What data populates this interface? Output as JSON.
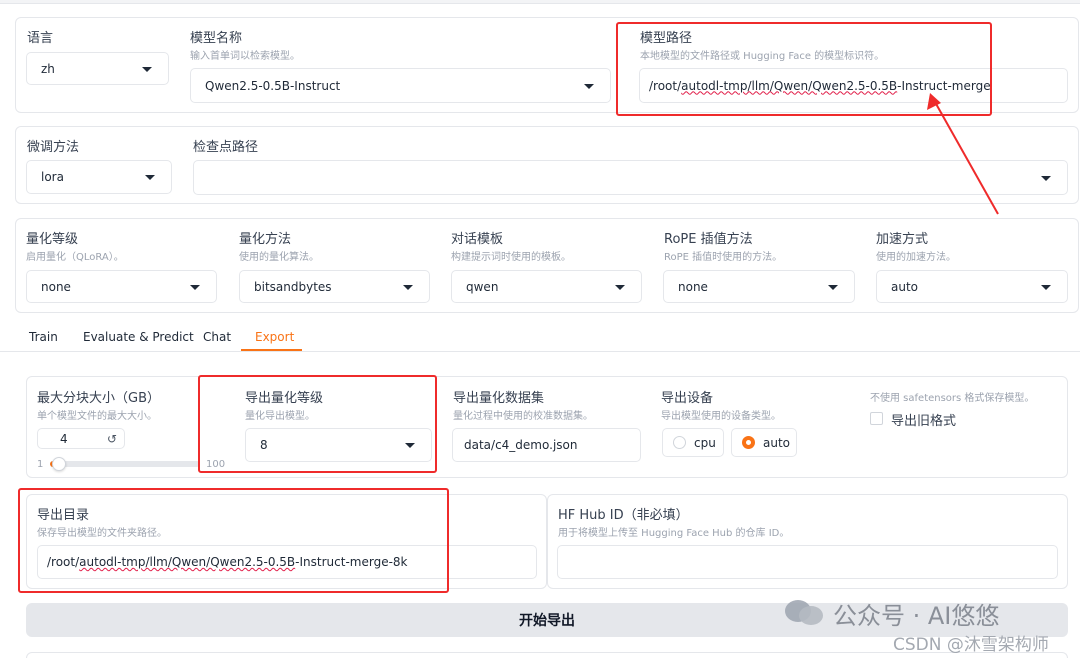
{
  "language": {
    "label": "语言",
    "value": "zh"
  },
  "model_name": {
    "label": "模型名称",
    "hint": "输入首单词以检索模型。",
    "value": "Qwen2.5-0.5B-Instruct"
  },
  "model_path": {
    "label": "模型路径",
    "hint": "本地模型的文件路径或 Hugging Face 的模型标识符。",
    "value_prefix": "/root/",
    "value_path": "autodl-tmp/llm/Qwen/Qwen2.5-0.5B",
    "value_suffix": "-Instruct-merge"
  },
  "finetune": {
    "label": "微调方法",
    "value": "lora"
  },
  "checkpoint": {
    "label": "检查点路径",
    "value": ""
  },
  "quant_level": {
    "label": "量化等级",
    "hint": "启用量化（QLoRA）。",
    "value": "none"
  },
  "quant_method": {
    "label": "量化方法",
    "hint": "使用的量化算法。",
    "value": "bitsandbytes"
  },
  "template": {
    "label": "对话模板",
    "hint": "构建提示词时使用的模板。",
    "value": "qwen"
  },
  "rope": {
    "label": "RoPE 插值方法",
    "hint": "RoPE 插值时使用的方法。",
    "value": "none"
  },
  "accel": {
    "label": "加速方式",
    "hint": "使用的加速方法。",
    "value": "auto"
  },
  "tabs": [
    {
      "label": "Train"
    },
    {
      "label": "Evaluate & Predict"
    },
    {
      "label": "Chat"
    },
    {
      "label": "Export"
    }
  ],
  "export": {
    "shard": {
      "label": "最大分块大小（GB）",
      "hint": "单个模型文件的最大大小。",
      "value": "4",
      "reset_icon": "↺",
      "min": "1",
      "max": "100",
      "fraction": 0.03
    },
    "quant_bit": {
      "label": "导出量化等级",
      "hint": "量化导出模型。",
      "value": "8"
    },
    "quant_dataset": {
      "label": "导出量化数据集",
      "hint": "量化过程中使用的校准数据集。",
      "value": "data/c4_demo.json"
    },
    "device": {
      "label": "导出设备",
      "hint": "导出模型使用的设备类型。",
      "options": [
        "cpu",
        "auto"
      ],
      "selected": "auto"
    },
    "legacy": {
      "hint": "不使用 safetensors 格式保存模型。",
      "label": "导出旧格式"
    },
    "dir": {
      "label": "导出目录",
      "hint": "保存导出模型的文件夹路径。",
      "value_prefix": "/root/",
      "value_path": "autodl-tmp/llm/Qwen/Qwen2.5-0.5B",
      "value_suffix": "-Instruct-merge-8k"
    },
    "hub": {
      "label": "HF Hub ID（非必填）",
      "hint": "用于将模型上传至 Hugging Face Hub 的仓库 ID。",
      "value": ""
    },
    "button": "开始导出"
  },
  "watermark": {
    "line1": "公众号 · AI悠悠",
    "line2": "CSDN @沐雪架构师"
  },
  "colors": {
    "accent": "#f97316",
    "annotation": "#ef2b2b"
  }
}
